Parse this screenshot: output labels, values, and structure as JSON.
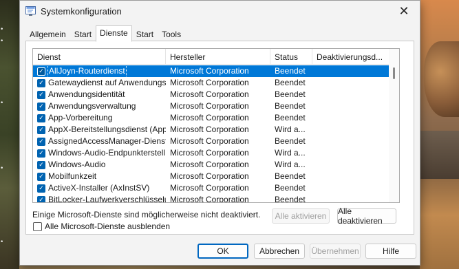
{
  "window": {
    "title": "Systemkonfiguration",
    "close_glyph": "✕"
  },
  "tabs": [
    {
      "label": "Allgemein",
      "active": false
    },
    {
      "label": "Start",
      "active": false
    },
    {
      "label": "Dienste",
      "active": true
    },
    {
      "label": "Start",
      "active": false
    },
    {
      "label": "Tools",
      "active": false
    }
  ],
  "services": {
    "columns": [
      "Dienst",
      "Hersteller",
      "Status",
      "Deaktivierungsd..."
    ],
    "rows": [
      {
        "name": "AllJoyn-Routerdienst",
        "vendor": "Microsoft Corporation",
        "status": "Beendet",
        "disabled_date": "",
        "checked": true,
        "selected": true
      },
      {
        "name": "Gatewaydienst auf Anwendungs...",
        "vendor": "Microsoft Corporation",
        "status": "Beendet",
        "disabled_date": "",
        "checked": true,
        "selected": false
      },
      {
        "name": "Anwendungsidentität",
        "vendor": "Microsoft Corporation",
        "status": "Beendet",
        "disabled_date": "",
        "checked": true,
        "selected": false
      },
      {
        "name": "Anwendungsverwaltung",
        "vendor": "Microsoft Corporation",
        "status": "Beendet",
        "disabled_date": "",
        "checked": true,
        "selected": false
      },
      {
        "name": "App-Vorbereitung",
        "vendor": "Microsoft Corporation",
        "status": "Beendet",
        "disabled_date": "",
        "checked": true,
        "selected": false
      },
      {
        "name": "AppX-Bereitstellungsdienst (App...",
        "vendor": "Microsoft Corporation",
        "status": "Wird a...",
        "disabled_date": "",
        "checked": true,
        "selected": false
      },
      {
        "name": "AssignedAccessManager-Dienst",
        "vendor": "Microsoft Corporation",
        "status": "Beendet",
        "disabled_date": "",
        "checked": true,
        "selected": false
      },
      {
        "name": "Windows-Audio-Endpunkterstell...",
        "vendor": "Microsoft Corporation",
        "status": "Wird a...",
        "disabled_date": "",
        "checked": true,
        "selected": false
      },
      {
        "name": "Windows-Audio",
        "vendor": "Microsoft Corporation",
        "status": "Wird a...",
        "disabled_date": "",
        "checked": true,
        "selected": false
      },
      {
        "name": "Mobilfunkzeit",
        "vendor": "Microsoft Corporation",
        "status": "Beendet",
        "disabled_date": "",
        "checked": true,
        "selected": false
      },
      {
        "name": "ActiveX-Installer (AxInstSV)",
        "vendor": "Microsoft Corporation",
        "status": "Beendet",
        "disabled_date": "",
        "checked": true,
        "selected": false
      },
      {
        "name": "BitLocker-Laufwerkverschlüsselu...",
        "vendor": "Microsoft Corporation",
        "status": "Beendet",
        "disabled_date": "",
        "checked": true,
        "selected": false
      }
    ]
  },
  "panel": {
    "note": "Einige Microsoft-Dienste sind möglicherweise nicht deaktiviert.",
    "enable_all": "Alle aktivieren",
    "disable_all": "Alle deaktivieren",
    "hide_ms_label": "Alle Microsoft-Dienste ausblenden"
  },
  "footer": {
    "ok": "OK",
    "cancel": "Abbrechen",
    "apply": "Übernehmen",
    "help": "Hilfe"
  }
}
